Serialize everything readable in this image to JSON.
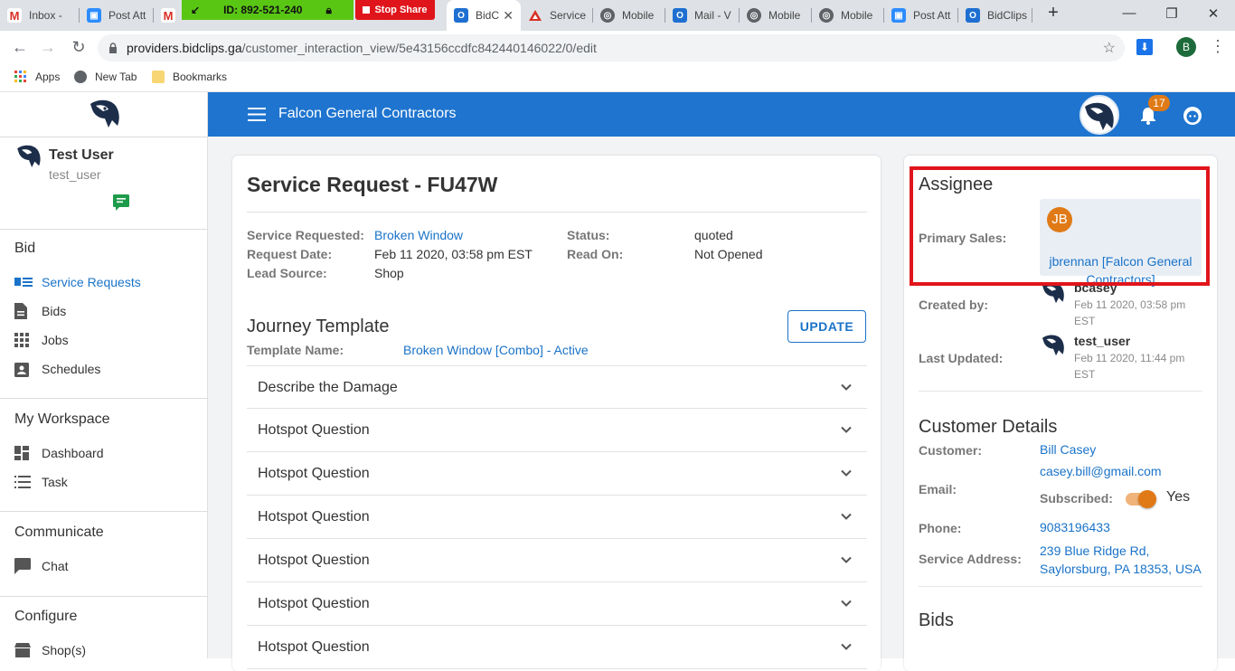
{
  "browser": {
    "tabs": [
      {
        "label": "Inbox -",
        "icon": "gmail-icon",
        "color": "#d93025"
      },
      {
        "label": "Post Att",
        "icon": "zoom-icon",
        "color": "#2d8cff"
      },
      {
        "label": "",
        "icon": "gmail-icon",
        "color": "#d93025"
      },
      {
        "label": "BidC",
        "icon": "outlook-icon",
        "color": "#1e6fd1"
      },
      {
        "label": "Service",
        "icon": "service-icon",
        "color": "#d93025"
      },
      {
        "label": "Mobile",
        "icon": "globe-icon",
        "color": "#5f6368"
      },
      {
        "label": "Mail - V",
        "icon": "outlook-icon",
        "color": "#1e6fd1"
      },
      {
        "label": "Mobile",
        "icon": "globe-icon",
        "color": "#5f6368"
      },
      {
        "label": "Mobile",
        "icon": "globe-icon",
        "color": "#5f6368"
      },
      {
        "label": "Post Att",
        "icon": "zoom-icon",
        "color": "#2d8cff"
      },
      {
        "label": "BidClips",
        "icon": "outlook-icon",
        "color": "#1e6fd1"
      }
    ],
    "share_id": "ID: 892-521-240",
    "stop_share": "Stop Share",
    "url_host": "providers.bidclips.ga",
    "url_path": "/customer_interaction_view/5e43156ccdfc842440146022/0/edit",
    "profile_initial": "B",
    "bookmarks": [
      "Apps",
      "New Tab",
      "Bookmarks"
    ]
  },
  "sidebar": {
    "user_name": "Test User",
    "user_handle": "test_user",
    "sections": [
      {
        "title": "Bid",
        "items": [
          "Service Requests",
          "Bids",
          "Jobs",
          "Schedules"
        ]
      },
      {
        "title": "My Workspace",
        "items": [
          "Dashboard",
          "Task"
        ]
      },
      {
        "title": "Communicate",
        "items": [
          "Chat"
        ]
      },
      {
        "title": "Configure",
        "items": [
          "Shop(s)"
        ]
      }
    ]
  },
  "header": {
    "company": "Falcon General Contractors",
    "notification_count": "17"
  },
  "request": {
    "title": "Service Request - FU47W",
    "fields": {
      "service_requested_label": "Service Requested:",
      "service_requested": "Broken Window",
      "request_date_label": "Request Date:",
      "request_date": "Feb 11 2020, 03:58 pm EST",
      "lead_source_label": "Lead Source:",
      "lead_source": "Shop",
      "status_label": "Status:",
      "status": "quoted",
      "read_on_label": "Read On:",
      "read_on": "Not Opened"
    },
    "journey_title": "Journey Template",
    "update_label": "UPDATE",
    "template_name_label": "Template Name:",
    "template_name": "Broken Window [Combo] - Active",
    "questions": [
      "Describe the Damage",
      "Hotspot Question",
      "Hotspot Question",
      "Hotspot Question",
      "Hotspot Question",
      "Hotspot Question",
      "Hotspot Question"
    ]
  },
  "assignee": {
    "title": "Assignee",
    "primary_sales_label": "Primary Sales:",
    "initials": "JB",
    "primary_sales_line1": "jbrennan [Falcon General",
    "primary_sales_line2": "Contractors]",
    "created_by_label": "Created by:",
    "created_by_name": "bcasey",
    "created_by_date": "Feb 11 2020, 03:58 pm",
    "created_by_tz": "EST",
    "updated_label": "Last Updated:",
    "updated_name": "test_user",
    "updated_date": "Feb 11 2020, 11:44 pm",
    "updated_tz": "EST"
  },
  "customer": {
    "title": "Customer Details",
    "customer_label": "Customer:",
    "customer": "Bill Casey",
    "email_label": "Email:",
    "email": "casey.bill@gmail.com",
    "subscribed_label": "Subscribed:",
    "subscribed_value": "Yes",
    "phone_label": "Phone:",
    "phone": "9083196433",
    "address_label": "Service Address:",
    "address_line1": "239 Blue Ridge Rd,",
    "address_line2": "Saylorsburg, PA 18353, USA"
  },
  "bids": {
    "title": "Bids"
  },
  "colors": {
    "brand_blue": "#1e74cf",
    "link_blue": "#1a73c8",
    "highlight_red": "#e0151b",
    "badge_orange": "#e07a16",
    "toggle_orange": "#e07a16"
  }
}
